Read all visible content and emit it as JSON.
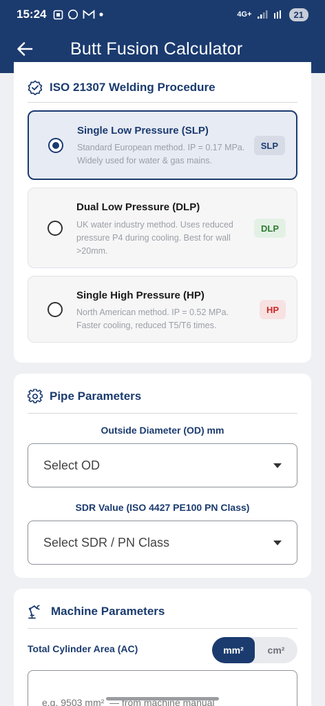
{
  "status": {
    "time": "15:24",
    "left_icons": [
      "screenshot-icon",
      "whatsapp-icon",
      "gmail-icon",
      "dot-icon"
    ],
    "network": "4G+",
    "battery": "21"
  },
  "appbar": {
    "title": "Butt Fusion Calculator"
  },
  "procedure": {
    "heading": "ISO 21307 Welding Procedure",
    "options": [
      {
        "title": "Single Low Pressure (SLP)",
        "desc": "Standard European method. IP = 0.17 MPa. Widely used for water & gas mains.",
        "badge": "SLP",
        "selected": true,
        "badge_color": "#1b3b6f",
        "badge_bg": "#d6dbe6"
      },
      {
        "title": "Dual Low Pressure (DLP)",
        "desc": "UK water industry method. Uses reduced pressure P4 during cooling. Best for wall >20mm.",
        "badge": "DLP",
        "selected": false,
        "badge_color": "#2e7d32",
        "badge_bg": "#e3f1e4"
      },
      {
        "title": "Single High Pressure (HP)",
        "desc": "North American method. IP = 0.52 MPa. Faster cooling, reduced T5/T6 times.",
        "badge": "HP",
        "selected": false,
        "badge_color": "#c62828",
        "badge_bg": "#f8e1e1"
      }
    ]
  },
  "pipe": {
    "heading": "Pipe Parameters",
    "od_label": "Outside Diameter (OD) mm",
    "od_value": "Select OD",
    "sdr_label": "SDR Value  (ISO 4427 PE100 PN Class)",
    "sdr_value": "Select SDR / PN Class"
  },
  "machine": {
    "heading": "Machine Parameters",
    "ac_label": "Total Cylinder Area (AC)",
    "units": [
      "mm²",
      "cm²"
    ],
    "active_unit": "mm²",
    "ac_placeholder": "e.g. 9503 mm²  — from machine manual"
  },
  "colors": {
    "primary": "#1b3b6f"
  }
}
